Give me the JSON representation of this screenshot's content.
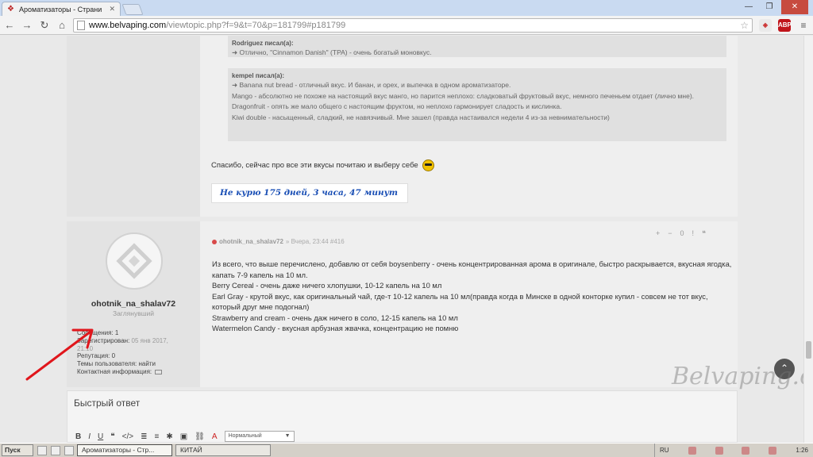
{
  "browser": {
    "tab_title": "Ароматизаторы - Страни",
    "url_host": "www.belvaping.com",
    "url_path": "/viewtopic.php?f=9&t=70&p=181799#p181799",
    "ext_abp": "ABP"
  },
  "post1": {
    "quote1_author": "Rodriguez писал(а):",
    "quote1_lines": [
      "➜ Отлично, \"Cinnamon Danish\" (TPA) - очень богатый моновкус."
    ],
    "quote2_author": "kempel писал(а):",
    "quote2_lines": [
      "➜ Banana nut bread - отличный вкус. И банан, и орех, и выпечка в одном ароматизаторе.",
      "Mango - абсолютно не похоже на настоящий вкус манго, но парится неплохо: сладковатый фруктовый вкус, немного печеньем отдает (лично мне).",
      "Dragonfruit - опять же мало общего с настоящим фруктом, но неплохо гармонирует сладость и кислинка.",
      "Kiwi double - насыщенный, сладкий, не навязчивый. Мне зашел (правда настаивался недели 4 из-за невнимательности)"
    ],
    "thanks_text": "Спасибо, сейчас про все эти вкусы почитаю и выберу себе",
    "signature": "Не курю  175 дней, 3 часа, 47 минут"
  },
  "post2": {
    "username": "ohotnik_na_shalav72",
    "rank": "Заглянувший",
    "profile": {
      "messages_label": "Сообщения:",
      "messages_value": "1",
      "registered_label": "Зарегистрирован:",
      "registered_value": "05 янв 2017,",
      "registered_time": "21:10",
      "reputation_label": "Репутация:",
      "reputation_value": "0",
      "topics_label": "Темы пользователя:",
      "topics_value": "найти",
      "contact_label": "Контактная информация:"
    },
    "header_author": "ohotnik_na_shalav72",
    "header_meta": "» Вчера, 23:44 #416",
    "actions": [
      "+",
      "−",
      "0",
      "!",
      "❝"
    ],
    "body": [
      "Из всего, что выше перечислено, добавлю от себя boysenberry - очень концентрированная арома в оригинале, быстро раскрывается, вкусная ягодка, капать 7-9 капель на 10 мл.",
      "Berry Cereal - очень даже ничего хлопушки, 10-12 капель на 10 мл",
      "Earl Gray - крутой вкус, как оригинальный чай, где-т 10-12 капель на 10 мл(правда когда в Минске в одной конторке купил - совсем не тот вкус, который друг мне подогнал)",
      "Strawberry and cream - очень даж ничего в соло, 12-15 капель на 10 мл",
      "Watermelon Candy - вкусная арбузная жвачка, концентрацию не помню"
    ]
  },
  "reply": {
    "title": "Быстрый ответ",
    "format_select": "Нормальный",
    "toolbar": [
      "B",
      "I",
      "U",
      "❝",
      "</>",
      "≣",
      "≡",
      "✱",
      "▣",
      "⛓",
      "A"
    ]
  },
  "watermark": "Belvaping.com",
  "taskbar": {
    "start": "Пуск",
    "task1": "Ароматизаторы - Стр...",
    "task2": "КИТАЙ",
    "lang": "RU",
    "clock": "1:26"
  },
  "colors": {
    "accent_red": "#d84a4a",
    "signature_blue": "#1a4fb5"
  }
}
